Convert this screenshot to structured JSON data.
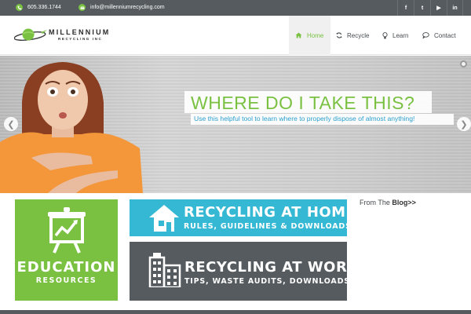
{
  "topbar": {
    "phone": "605.336.1744",
    "email": "info@millenniumrecycling.com",
    "social": [
      {
        "icon": "facebook-icon",
        "glyph": "f"
      },
      {
        "icon": "twitter-icon",
        "glyph": "t"
      },
      {
        "icon": "youtube-icon",
        "glyph": "▶"
      },
      {
        "icon": "linkedin-icon",
        "glyph": "in"
      }
    ]
  },
  "logo": {
    "name": "MILLENNIUM",
    "tagline": "RECYCLING INC"
  },
  "nav": [
    {
      "label": "Home",
      "icon": "home-icon",
      "active": true
    },
    {
      "label": "Recycle",
      "icon": "refresh-icon",
      "active": false
    },
    {
      "label": "Learn",
      "icon": "lightbulb-icon",
      "active": false
    },
    {
      "label": "Contact",
      "icon": "chat-bubble-icon",
      "active": false
    }
  ],
  "hero": {
    "title": "WHERE DO I TAKE THIS?",
    "subtitle": "Use this helpful tool to learn where to properly dispose of almost anything!"
  },
  "education": {
    "title": "EDUCATION",
    "subtitle": "RESOURCES"
  },
  "cards": {
    "home": {
      "title": "RECYCLING AT HOME",
      "subtitle": "RULES, GUIDELINES & DOWNLOADS"
    },
    "work": {
      "title": "RECYCLING AT WORK",
      "subtitle": "TIPS, WASTE AUDITS, DOWNLOADS"
    }
  },
  "blog": {
    "prefix": "From The",
    "link": "Blog>>"
  },
  "colors": {
    "brand_green": "#7ac142",
    "accent_blue": "#34b8d4",
    "dark_gray": "#555b5e"
  }
}
